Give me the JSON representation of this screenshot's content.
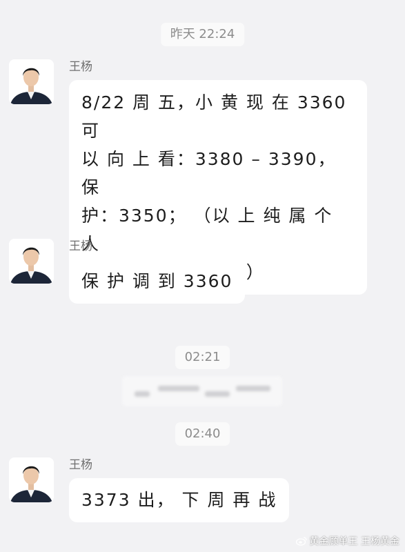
{
  "chat": {
    "timestamps": [
      "昨天 22:24",
      "02:21",
      "02:40"
    ],
    "messages": [
      {
        "sender": "王杨",
        "lines": [
          "8/22 周 五，小 黄 现 在 3360 可",
          "以 向 上 看：3380 – 3390，保",
          "护：3350；  （以 上 纯 属 个 人",
          "分 享，仅 供 参 考 ）"
        ]
      },
      {
        "sender": "王杨",
        "text": "保 护 调 到 3360"
      },
      {
        "sender": "王杨",
        "text": "3373 出，  下 周 再 战"
      }
    ]
  },
  "watermark": {
    "text": "黄金顾单王 王杨黄金"
  },
  "colors": {
    "background": "#f2f2f4",
    "bubble": "#ffffff",
    "timestamp_text": "#8c8c8c"
  }
}
